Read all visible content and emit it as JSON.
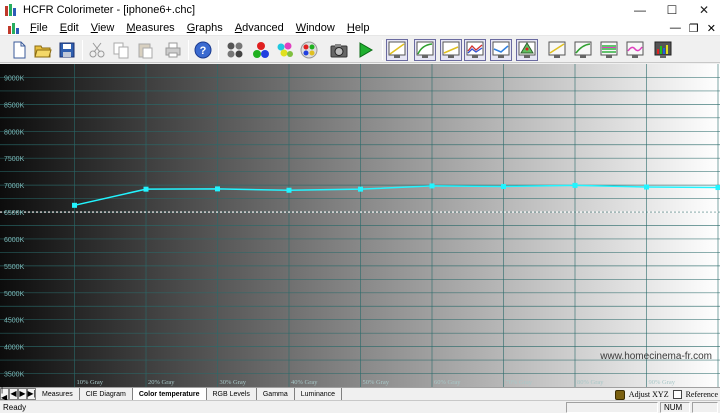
{
  "window": {
    "title": "HCFR Colorimeter - [iphone6+.chc]",
    "minimize_glyph": "—",
    "maximize_glyph": "☐",
    "close_glyph": "✕"
  },
  "menu": {
    "items": [
      {
        "accel": "F",
        "rest": "ile"
      },
      {
        "accel": "E",
        "rest": "dit"
      },
      {
        "accel": "V",
        "rest": "iew"
      },
      {
        "accel": "M",
        "rest": "easures"
      },
      {
        "accel": "G",
        "rest": "raphs"
      },
      {
        "accel": "A",
        "rest": "dvanced"
      },
      {
        "accel": "W",
        "rest": "indow"
      },
      {
        "accel": "H",
        "rest": "elp"
      }
    ],
    "mdi_minimize": "—",
    "mdi_restore": "❐",
    "mdi_close": "✕"
  },
  "toolbar": {
    "icons": [
      "new-file-icon",
      "open-folder-icon",
      "save-icon",
      "cut-icon",
      "copy-icon",
      "paste-icon",
      "print-icon",
      "help-icon",
      "sensor-icon",
      "rgb-balls-icon",
      "color-balls-icon",
      "color-chart-icon",
      "camera-icon",
      "play-icon",
      "graph-view-1-icon",
      "graph-view-2-icon",
      "graph-view-3-icon",
      "graph-view-4-icon",
      "graph-view-5-icon",
      "graph-view-6-icon",
      "graph-view-7-icon",
      "graph-view-8-icon",
      "graph-view-9-icon",
      "graph-view-10-icon",
      "graph-view-11-icon"
    ]
  },
  "chart_data": {
    "type": "line",
    "ylabels": [
      "9000K",
      "8500K",
      "8000K",
      "7500K",
      "7000K",
      "6500K",
      "6000K",
      "5500K",
      "5000K",
      "4500K",
      "4000K",
      "3500K"
    ],
    "xlabels": [
      "10% Gray",
      "20% Gray",
      "30% Gray",
      "40% Gray",
      "50% Gray",
      "60% Gray",
      "70% Gray",
      "80% Gray",
      "90% Gray"
    ],
    "ylim": [
      3250,
      9250
    ],
    "reference": 6500,
    "series": [
      {
        "color": "#22f4ff",
        "x": [
          10,
          20,
          30,
          40,
          50,
          60,
          70,
          80,
          90,
          100
        ],
        "values": [
          6625,
          6925,
          6930,
          6905,
          6925,
          6985,
          6975,
          6995,
          6965,
          6955
        ]
      }
    ],
    "grid": true,
    "watermark": "www.homecinema-fr.com"
  },
  "tabs": {
    "nav": [
      "|◀",
      "◀",
      "▶",
      "▶|"
    ],
    "items": [
      "Measures",
      "CIE Diagram",
      "Color temperature",
      "RGB Levels",
      "Gamma",
      "Luminance"
    ],
    "active": 2,
    "adjust_label": "Adjust XYZ",
    "reference_label": "Reference"
  },
  "status": {
    "text": "Ready",
    "num": "NUM"
  }
}
